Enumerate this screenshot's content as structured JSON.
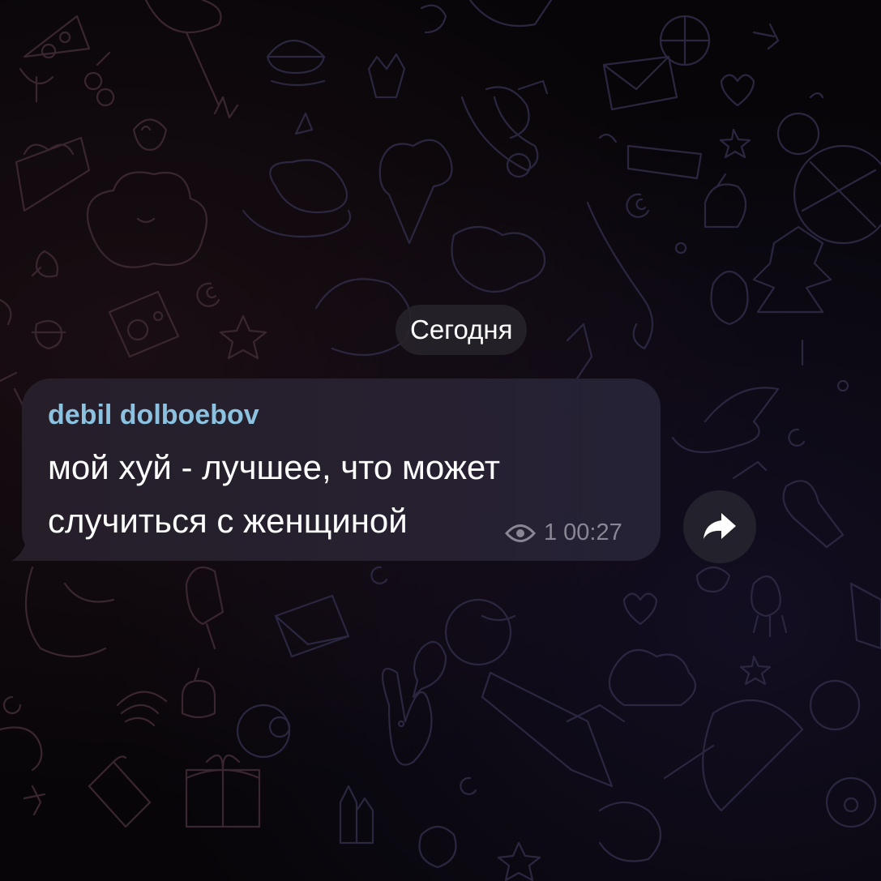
{
  "chat": {
    "date_separator": "Сегодня",
    "message": {
      "sender": "debil dolboebov",
      "text_line_1": "мой хуй - лучшее, что может",
      "text_line_2": "случиться с женщиной",
      "views": "1",
      "time": "00:27"
    }
  },
  "icons": {
    "views": "eye-icon",
    "forward": "share-arrow-icon"
  },
  "colors": {
    "background": "#070508",
    "bubble": "#262030",
    "sender_name": "#8bc2e0",
    "message_text": "#ffffff",
    "meta_text": "#8b8694",
    "date_pill": "#28242c"
  }
}
